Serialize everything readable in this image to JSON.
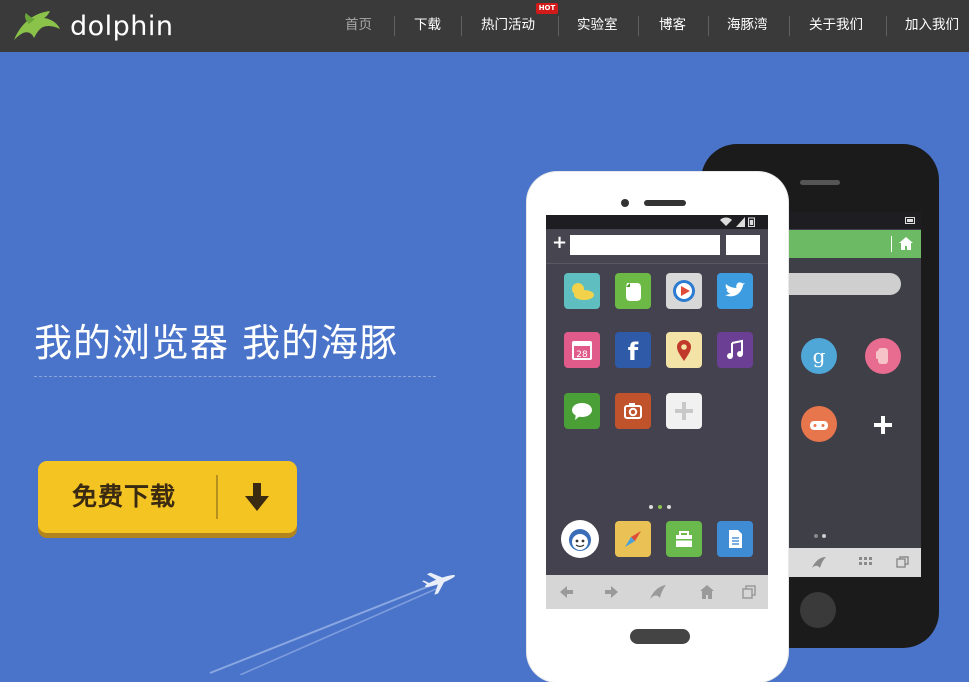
{
  "header": {
    "brand": "dolphin",
    "nav": [
      {
        "label": "首页",
        "active": true
      },
      {
        "label": "下载"
      },
      {
        "label": "热门活动",
        "badge": "HOT"
      },
      {
        "label": "实验室"
      },
      {
        "label": "博客"
      },
      {
        "label": "海豚湾"
      },
      {
        "label": "关于我们"
      },
      {
        "label": "加入我们"
      }
    ]
  },
  "hero": {
    "slogan": "我的浏览器  我的海豚",
    "download_label": "免费下载"
  },
  "phone_front": {
    "calendar_day": "28"
  },
  "colors": {
    "header_bg": "#3a3a3a",
    "hero_bg": "#4a74c9",
    "button": "#f4c423",
    "brand_green": "#8bc34a",
    "hot_badge": "#d21a1a"
  }
}
